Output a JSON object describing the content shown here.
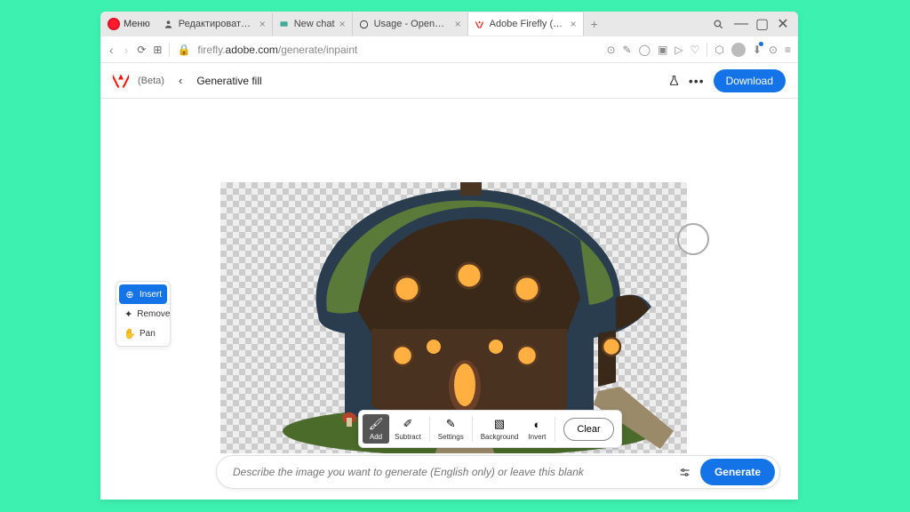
{
  "browser": {
    "menu_label": "Меню",
    "tabs": [
      {
        "label": "Редактировать запись \"M",
        "icon": "person"
      },
      {
        "label": "New chat",
        "icon": "chat"
      },
      {
        "label": "Usage - OpenAI API",
        "icon": "openai"
      },
      {
        "label": "Adobe Firefly (Beta)",
        "icon": "adobe",
        "active": true
      }
    ],
    "url_prefix": "firefly.",
    "url_host": "adobe.com",
    "url_path": "/generate/inpaint"
  },
  "header": {
    "beta_label": "(Beta)",
    "page_title": "Generative fill",
    "download_label": "Download"
  },
  "tools": {
    "items": [
      {
        "label": "Insert",
        "selected": true
      },
      {
        "label": "Remove",
        "selected": false
      },
      {
        "label": "Pan",
        "selected": false
      }
    ]
  },
  "bottom_toolbar": {
    "items": [
      {
        "label": "Add",
        "selected": true
      },
      {
        "label": "Subtract",
        "selected": false
      },
      {
        "label": "Settings",
        "selected": false
      },
      {
        "label": "Background",
        "selected": false
      },
      {
        "label": "Invert",
        "selected": false
      }
    ],
    "clear_label": "Clear"
  },
  "prompt": {
    "placeholder": "Describe the image you want to generate (English only) or leave this blank",
    "generate_label": "Generate"
  }
}
